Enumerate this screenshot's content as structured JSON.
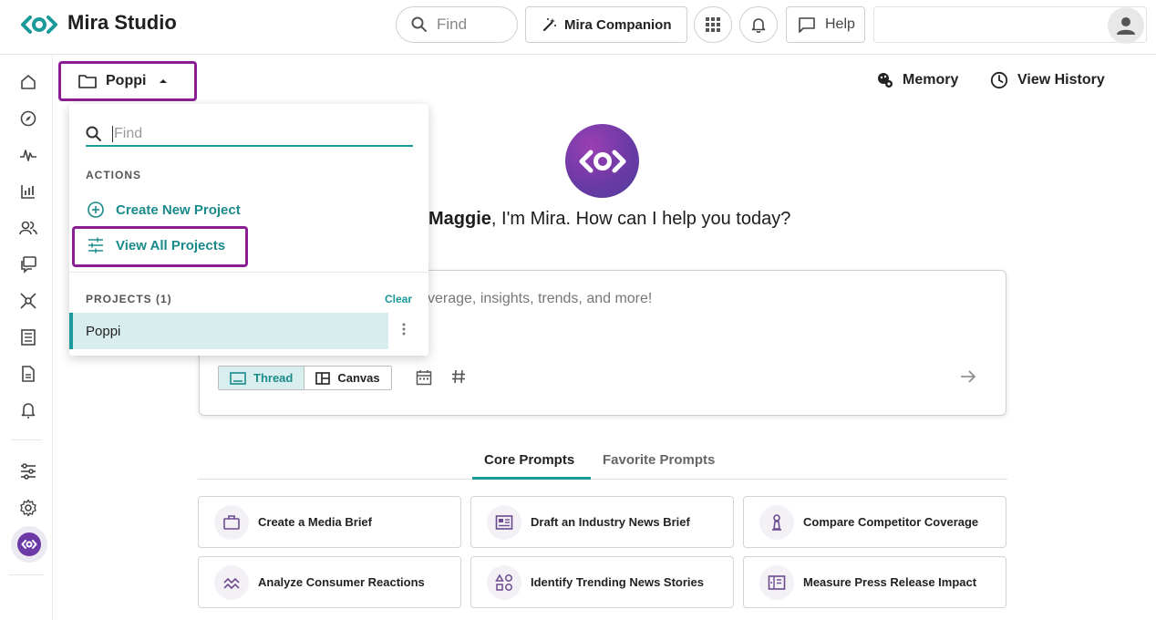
{
  "header": {
    "app_name": "Mira Studio",
    "search_placeholder": "Find",
    "companion_label": "Mira Companion",
    "help_label": "Help",
    "icons": [
      "mira-logo-icon",
      "search-icon",
      "magic-wand-icon",
      "apps-grid-icon",
      "bell-icon",
      "chat-bubble-icon",
      "user-icon"
    ]
  },
  "sidebar": {
    "icons": [
      "home-icon",
      "compass-icon",
      "pulse-icon",
      "bar-chart-icon",
      "people-icon",
      "chat-icon",
      "network-icon",
      "list-icon",
      "document-icon",
      "alert-icon",
      "sliders-icon",
      "settings-icon",
      "mira-icon"
    ]
  },
  "project_selector": {
    "label": "Poppi"
  },
  "toolbar": {
    "memory_label": "Memory",
    "history_label": "View History"
  },
  "hero": {
    "greeting_name": "Maggie",
    "greeting_rest": ", I'm Mira. How can I help you today?"
  },
  "prompt": {
    "placeholder": "verage, insights, trends, and more!",
    "modes": {
      "thread": "Thread",
      "canvas": "Canvas"
    },
    "selected_mode": "Thread"
  },
  "tabs": {
    "core": "Core Prompts",
    "favorite": "Favorite Prompts",
    "active": "Core Prompts"
  },
  "cards": [
    {
      "label": "Create a Media Brief",
      "icon": "briefcase-icon"
    },
    {
      "label": "Draft an Industry News Brief",
      "icon": "newspaper-icon"
    },
    {
      "label": "Compare Competitor Coverage",
      "icon": "chess-pawn-icon"
    },
    {
      "label": "Analyze Consumer Reactions",
      "icon": "trend-wave-icon"
    },
    {
      "label": "Identify Trending News Stories",
      "icon": "shapes-icon"
    },
    {
      "label": "Measure Press Release Impact",
      "icon": "press-release-icon"
    }
  ],
  "dropdown": {
    "search_placeholder": "Find",
    "actions_heading": "ACTIONS",
    "create_label": "Create New Project",
    "view_all_label": "View All Projects",
    "projects_heading": "PROJECTS (1)",
    "clear_label": "Clear",
    "projects": [
      "Poppi"
    ]
  },
  "colors": {
    "accent": "#1a9a9a",
    "highlight": "#8a1f94",
    "brand_purple": "#6c3aa6"
  }
}
